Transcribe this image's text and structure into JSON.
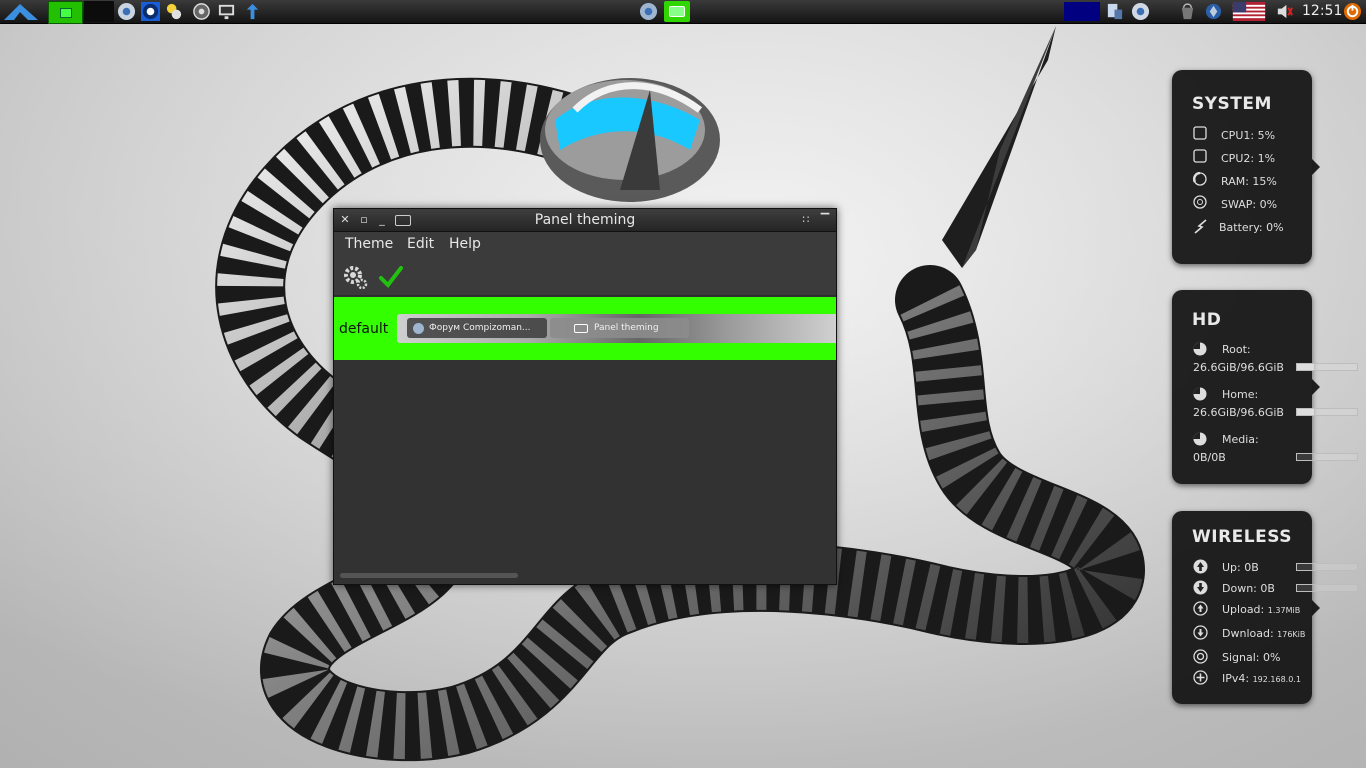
{
  "panel": {
    "clock": "12:51",
    "taskbar": []
  },
  "window": {
    "title": "Panel theming",
    "menu": [
      "Theme",
      "Edit",
      "Help"
    ],
    "theme_name": "default",
    "preview_tasks": [
      "Форум Compizoman...",
      "Panel theming"
    ]
  },
  "system": {
    "title": "SYSTEM",
    "rows": [
      {
        "icon": "cpu-icon",
        "label": "CPU1: 5%"
      },
      {
        "icon": "cpu-icon",
        "label": "CPU2: 1%"
      },
      {
        "icon": "ram-icon",
        "label": "RAM: 15%"
      },
      {
        "icon": "swap-icon",
        "label": "SWAP: 0%"
      },
      {
        "icon": "battery-icon",
        "label": "Battery: 0%"
      }
    ]
  },
  "hd": {
    "title": "HD",
    "rows": [
      {
        "label": "Root:",
        "value": "26.6GiB/96.6GiB",
        "fill": 0.28
      },
      {
        "label": "Home:",
        "value": "26.6GiB/96.6GiB",
        "fill": 0.28
      },
      {
        "label": "Media:",
        "value": "0B/0B",
        "fill": 0
      }
    ]
  },
  "wireless": {
    "title": "WIRELESS",
    "rows": [
      {
        "icon": "up-arrow-icon",
        "label": "Up: 0B",
        "detail": "",
        "bar": true
      },
      {
        "icon": "down-arrow-icon",
        "label": "Down: 0B",
        "detail": "",
        "bar": true
      },
      {
        "icon": "upload-icon",
        "label": "Upload:",
        "detail": "1.37MiB",
        "bar": false
      },
      {
        "icon": "download-icon",
        "label": "Dwnload:",
        "detail": "176KiB",
        "bar": false
      },
      {
        "icon": "signal-icon",
        "label": "Signal: 0%",
        "detail": "",
        "bar": false
      },
      {
        "icon": "ipv4-icon",
        "label": "IPv4:",
        "detail": "192.168.0.1",
        "bar": false
      }
    ]
  },
  "colors": {
    "theme_highlight": "#33ff00",
    "panel_dark": "#1a1a1a",
    "widget_bg": "#121212"
  }
}
